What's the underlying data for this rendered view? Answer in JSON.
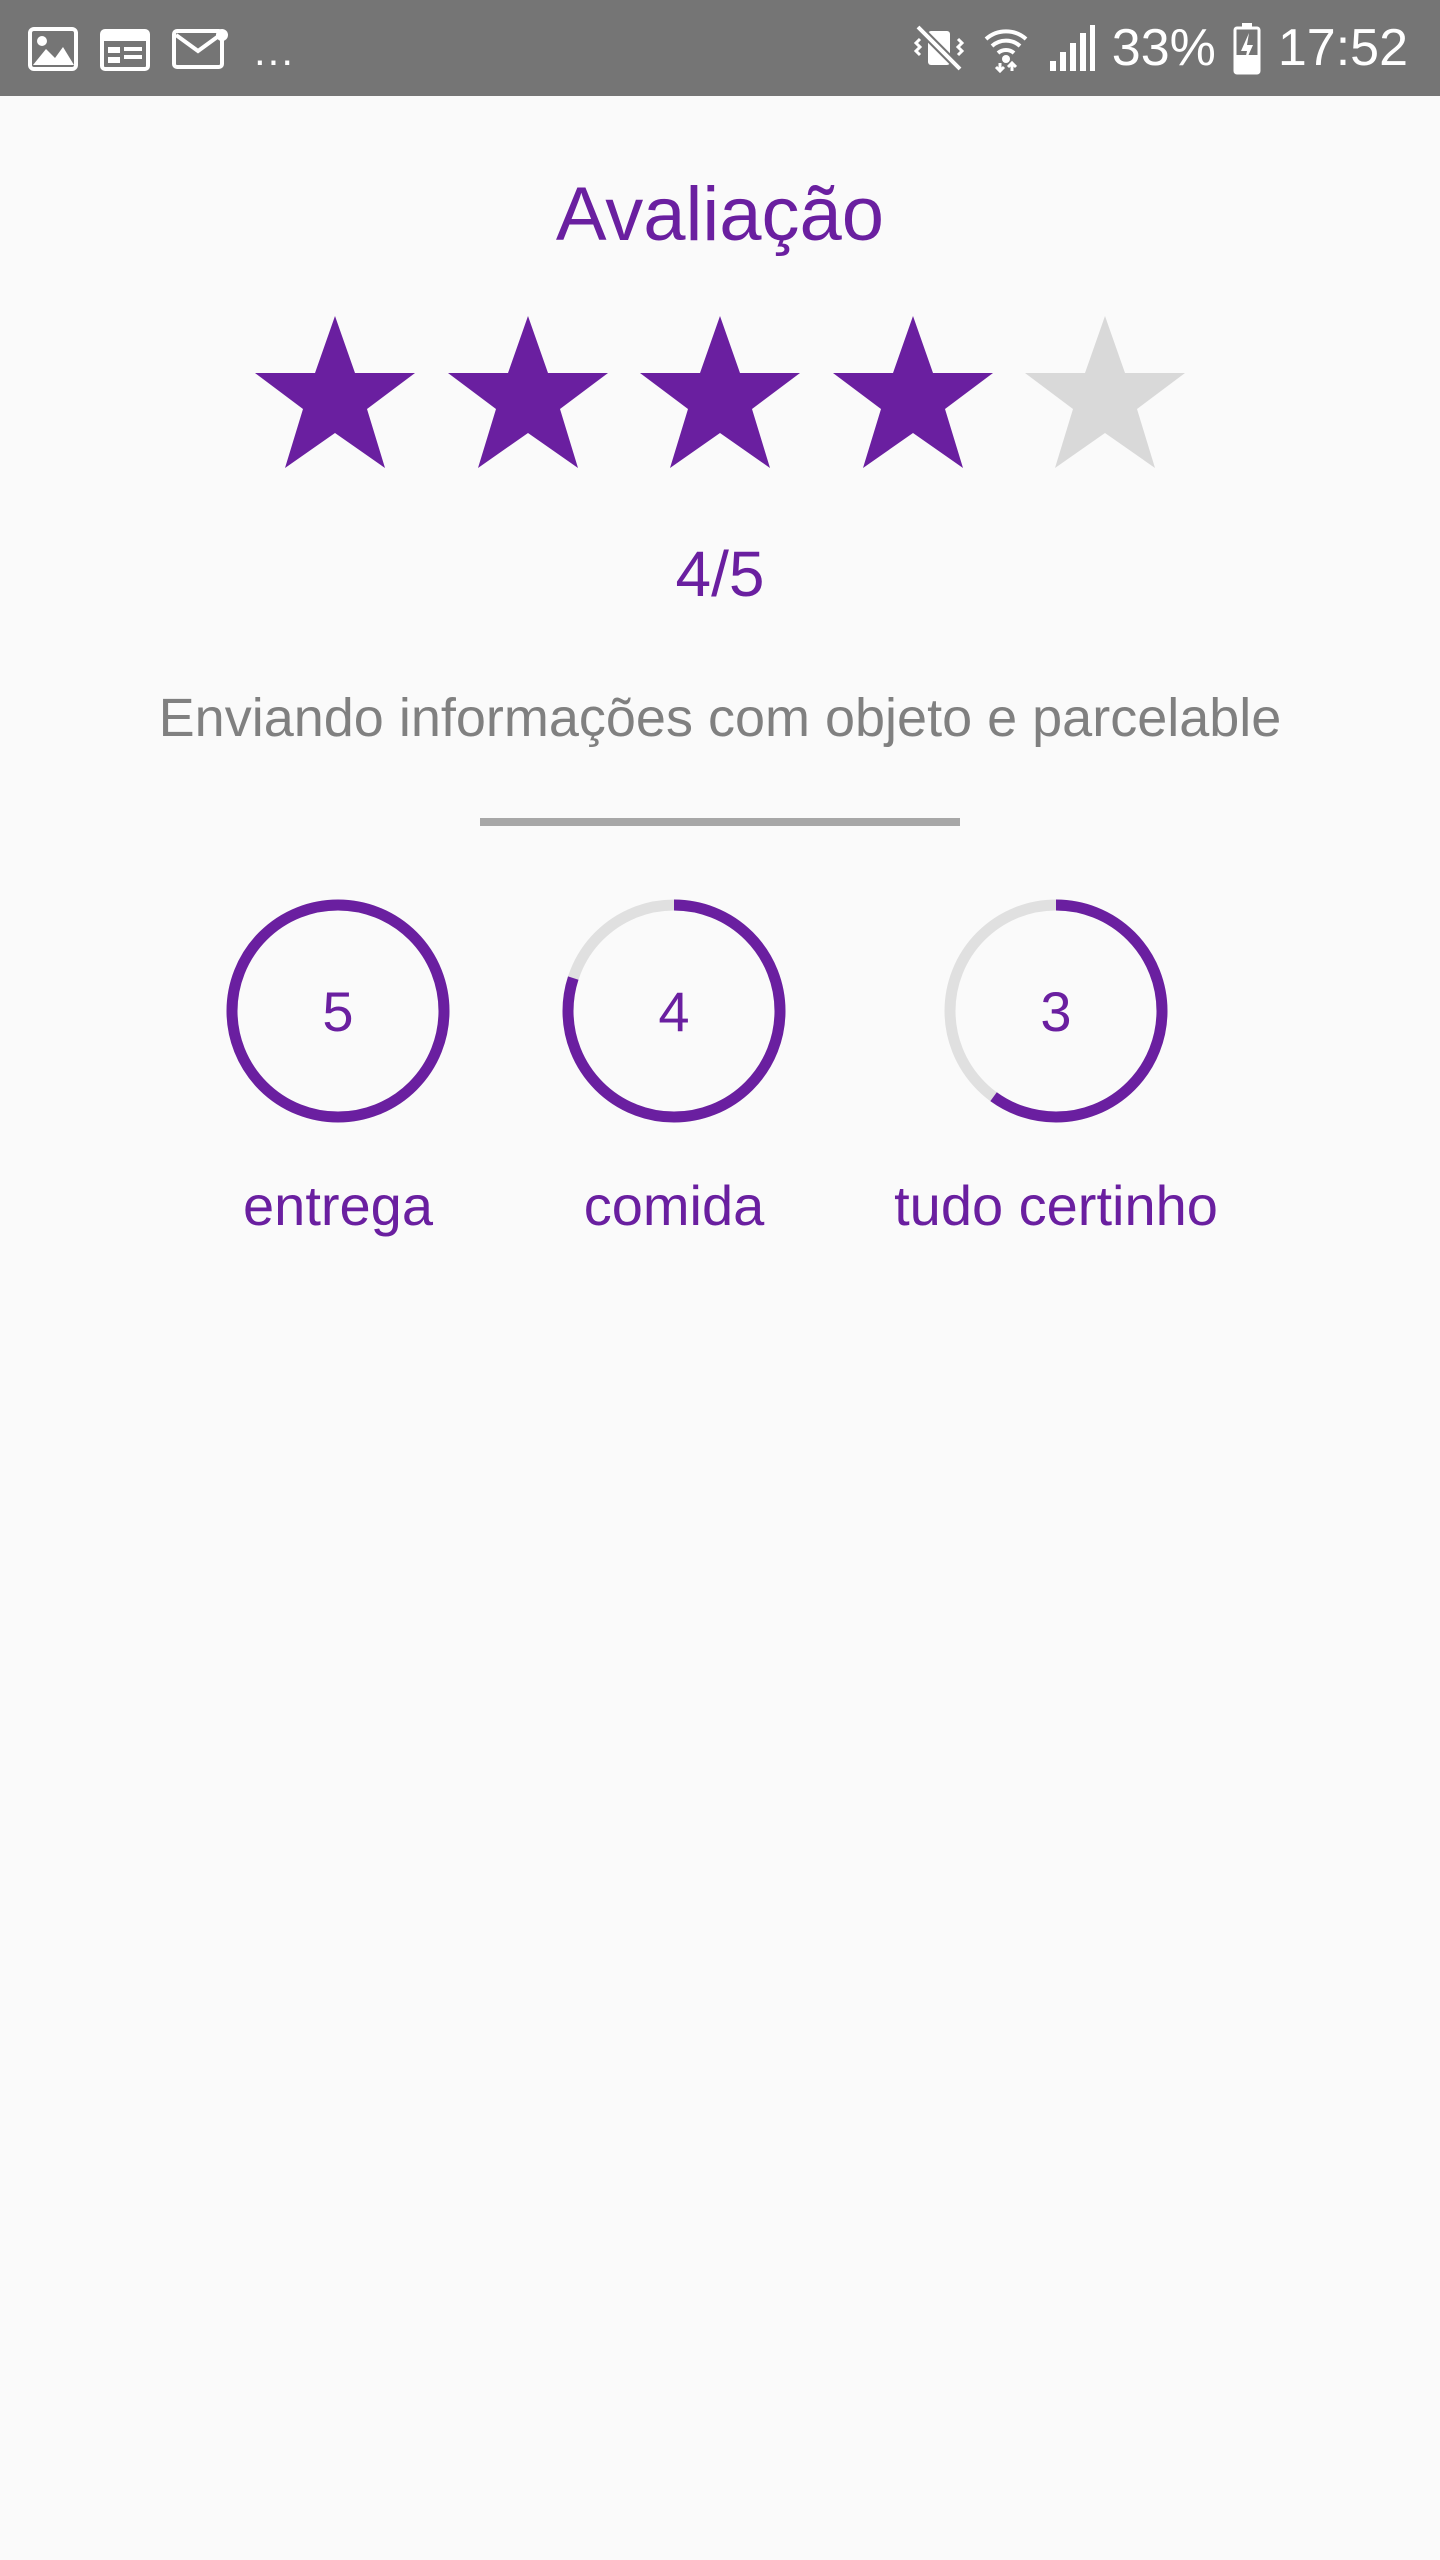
{
  "status_bar": {
    "left_icons": [
      "image-icon",
      "calendar-icon",
      "mail-icon"
    ],
    "more": "...",
    "right_icons": [
      "vibrate-mute-icon",
      "wifi-icon",
      "signal-icon",
      "battery-charging-icon"
    ],
    "battery": "33%",
    "time": "17:52",
    "background": "#757575"
  },
  "rating": {
    "title": "Avaliação",
    "value": 4,
    "max": 5,
    "score_text": "4/5",
    "subtitle": "Enviando informações com objeto e parcelable"
  },
  "colors": {
    "accent": "#6a1fa0",
    "star_empty": "#d9d9d9",
    "ring_track": "#e0e0e0",
    "subtitle": "#808080",
    "divider": "#a7a7a7"
  },
  "metrics": [
    {
      "value": "5",
      "label": "entrega",
      "fraction": 1.0
    },
    {
      "value": "4",
      "label": "comida",
      "fraction": 0.8
    },
    {
      "value": "3",
      "label": "tudo certinho",
      "fraction": 0.6
    }
  ]
}
